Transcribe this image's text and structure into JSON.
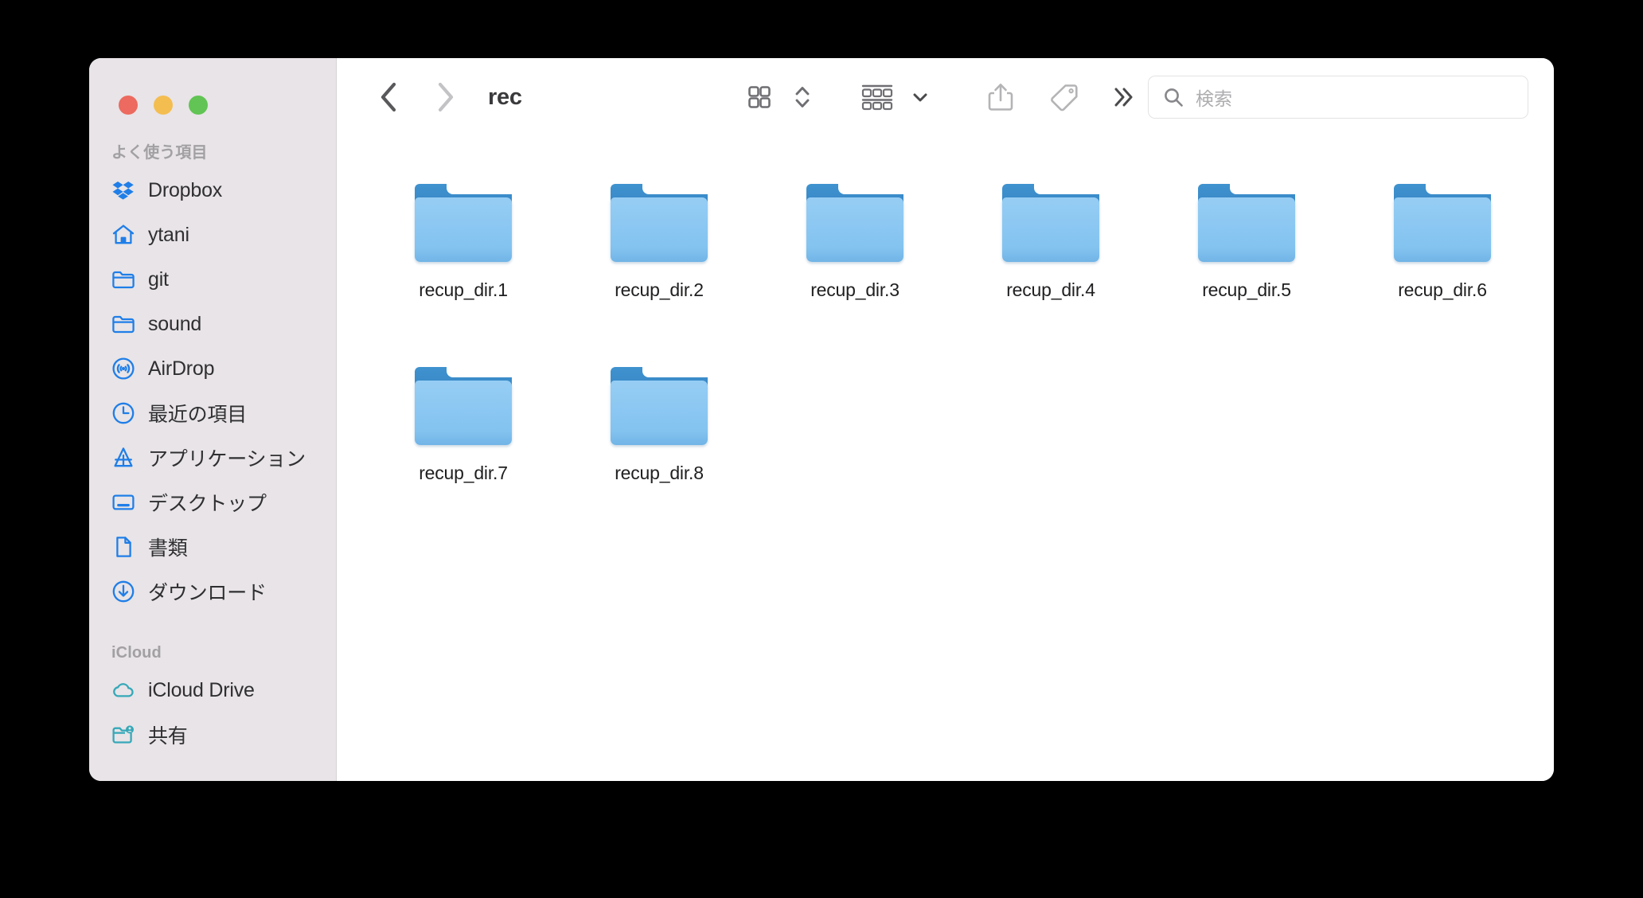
{
  "window": {
    "title": "rec",
    "traffic_lights": [
      {
        "name": "close",
        "color": "#ec6a5f"
      },
      {
        "name": "minimize",
        "color": "#f4bd50"
      },
      {
        "name": "zoom",
        "color": "#61c454"
      }
    ]
  },
  "toolbar": {
    "back_label": "戻る",
    "forward_label": "進む",
    "path_title": "rec",
    "view_icon": "grid-view-icon",
    "view_chevron": "chevron-up-down-icon",
    "group_icon": "group-by-icon",
    "group_chevron": "chevron-down-icon",
    "share_icon": "share-icon",
    "tag_icon": "tag-icon",
    "more_icon": "double-chevron-right-icon"
  },
  "search": {
    "icon": "search-icon",
    "placeholder": "検索",
    "value": ""
  },
  "sidebar": {
    "sections": [
      {
        "header": "よく使う項目",
        "items": [
          {
            "label": "Dropbox",
            "icon": "dropbox-icon",
            "color": "#1f7ee8"
          },
          {
            "label": "ytani",
            "icon": "home-icon",
            "color": "#1f7ee8"
          },
          {
            "label": "git",
            "icon": "folder-icon",
            "color": "#1f7ee8"
          },
          {
            "label": "sound",
            "icon": "folder-icon",
            "color": "#1f7ee8"
          },
          {
            "label": "AirDrop",
            "icon": "airdrop-icon",
            "color": "#1f7ee8"
          },
          {
            "label": "最近の項目",
            "icon": "clock-icon",
            "color": "#1f7ee8"
          },
          {
            "label": "アプリケーション",
            "icon": "applications-icon",
            "color": "#1f7ee8"
          },
          {
            "label": "デスクトップ",
            "icon": "desktop-icon",
            "color": "#1f7ee8"
          },
          {
            "label": "書類",
            "icon": "document-icon",
            "color": "#1f7ee8"
          },
          {
            "label": "ダウンロード",
            "icon": "download-icon",
            "color": "#1f7ee8"
          }
        ]
      },
      {
        "header": "iCloud",
        "items": [
          {
            "label": "iCloud Drive",
            "icon": "cloud-icon",
            "color": "#35a8b8"
          },
          {
            "label": "共有",
            "icon": "shared-folder-icon",
            "color": "#35a8b8"
          }
        ]
      }
    ]
  },
  "files": [
    {
      "name": "recup_dir.1",
      "kind": "folder"
    },
    {
      "name": "recup_dir.2",
      "kind": "folder"
    },
    {
      "name": "recup_dir.3",
      "kind": "folder"
    },
    {
      "name": "recup_dir.4",
      "kind": "folder"
    },
    {
      "name": "recup_dir.5",
      "kind": "folder"
    },
    {
      "name": "recup_dir.6",
      "kind": "folder"
    },
    {
      "name": "recup_dir.7",
      "kind": "folder"
    },
    {
      "name": "recup_dir.8",
      "kind": "folder"
    }
  ],
  "colors": {
    "sidebar_bg": "#e8e4e7",
    "content_bg": "#ffffff",
    "accent_blue": "#1f7ee8",
    "accent_teal": "#35a8b8",
    "folder_light": "#83c3f0",
    "folder_dark": "#3887c6",
    "desktop_bg": "#000000"
  }
}
